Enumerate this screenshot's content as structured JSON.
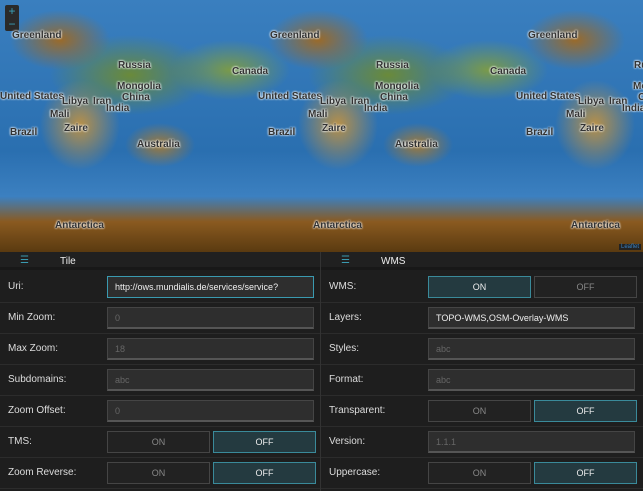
{
  "map": {
    "labels": [
      "Greenland",
      "Russia",
      "Canada",
      "United States",
      "Mongolia",
      "China",
      "Libya",
      "Iran",
      "India",
      "Mali",
      "Zaire",
      "Brazil",
      "Australia",
      "Antarctica"
    ],
    "zoom_in": "+",
    "zoom_out": "−",
    "attribution": "Leaflet"
  },
  "tile": {
    "title": "Tile",
    "uri": {
      "label": "Uri:",
      "value": "http://ows.mundialis.de/services/service?"
    },
    "min_zoom": {
      "label": "Min Zoom:",
      "placeholder": "0"
    },
    "max_zoom": {
      "label": "Max Zoom:",
      "placeholder": "18"
    },
    "subdomains": {
      "label": "Subdomains:",
      "placeholder": "abc"
    },
    "zoom_offset": {
      "label": "Zoom Offset:",
      "placeholder": "0"
    },
    "tms": {
      "label": "TMS:",
      "on": "ON",
      "off": "OFF",
      "value": "OFF"
    },
    "zoom_reverse": {
      "label": "Zoom Reverse:",
      "on": "ON",
      "off": "OFF",
      "value": "OFF"
    }
  },
  "wms": {
    "title": "WMS",
    "wms": {
      "label": "WMS:",
      "on": "ON",
      "off": "OFF",
      "value": "ON"
    },
    "layers": {
      "label": "Layers:",
      "value": "TOPO-WMS,OSM-Overlay-WMS"
    },
    "styles": {
      "label": "Styles:",
      "placeholder": "abc"
    },
    "format": {
      "label": "Format:",
      "placeholder": "abc"
    },
    "transparent": {
      "label": "Transparent:",
      "on": "ON",
      "off": "OFF",
      "value": "OFF"
    },
    "version": {
      "label": "Version:",
      "placeholder": "1.1.1"
    },
    "uppercase": {
      "label": "Uppercase:",
      "on": "ON",
      "off": "OFF",
      "value": "OFF"
    }
  },
  "colors": {
    "accent": "#3a9ab0",
    "background": "#1e1e1e"
  }
}
